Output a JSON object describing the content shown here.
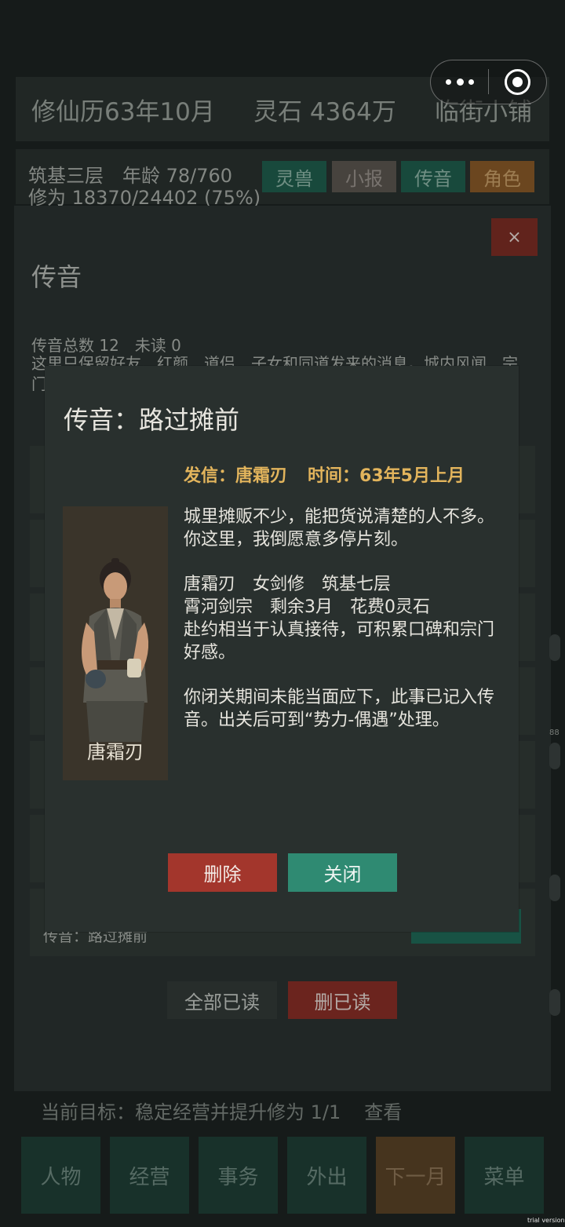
{
  "topbar": {
    "calendar": "修仙历63年10月",
    "spirit_stones": "灵石 4364万",
    "location": "临街小铺"
  },
  "status": {
    "line1": "筑基三层　年龄 78/760",
    "line2": "修为 18370/24402 (75%)",
    "tabs": {
      "beast": "灵兽",
      "news": "小报",
      "message": "传音",
      "role": "角色"
    }
  },
  "panel": {
    "close_glyph": "×",
    "title": "传音",
    "counts": "传音总数 12　未读 0",
    "description": "这里只保留好友、红颜、道侣、子女和同道发来的消息。城内风闻、宗门……",
    "last_row_text": "传音：路过摊前",
    "mark_all_read": "全部已读",
    "delete_read": "删已读"
  },
  "goal": {
    "text": "当前目标：稳定经营并提升修为 1/1",
    "view": "查看"
  },
  "nav": [
    "人物",
    "经营",
    "事务",
    "外出",
    "下一月",
    "菜单"
  ],
  "dialog": {
    "title": "传音：路过摊前",
    "sender": "发信：唐霜刃",
    "time": "时间：63年5月上月",
    "portrait_name": "唐霜刃",
    "para1": "城里摊贩不少，能把货说清楚的人不多。你这里，我倒愿意多停片刻。",
    "info_line1": "唐霜刃　女剑修　筑基七层",
    "info_line2": "霄河剑宗　剩余3月　花费0灵石",
    "info_line3": "赴约相当于认真接待，可积累口碑和宗门好感。",
    "para3": "你闭关期间未能当面应下，此事已记入传音。出关后可到“势力-偶遇”处理。",
    "delete_button": "删除",
    "close_button": "关闭"
  },
  "side_number": "88",
  "watermark": "trial version"
}
